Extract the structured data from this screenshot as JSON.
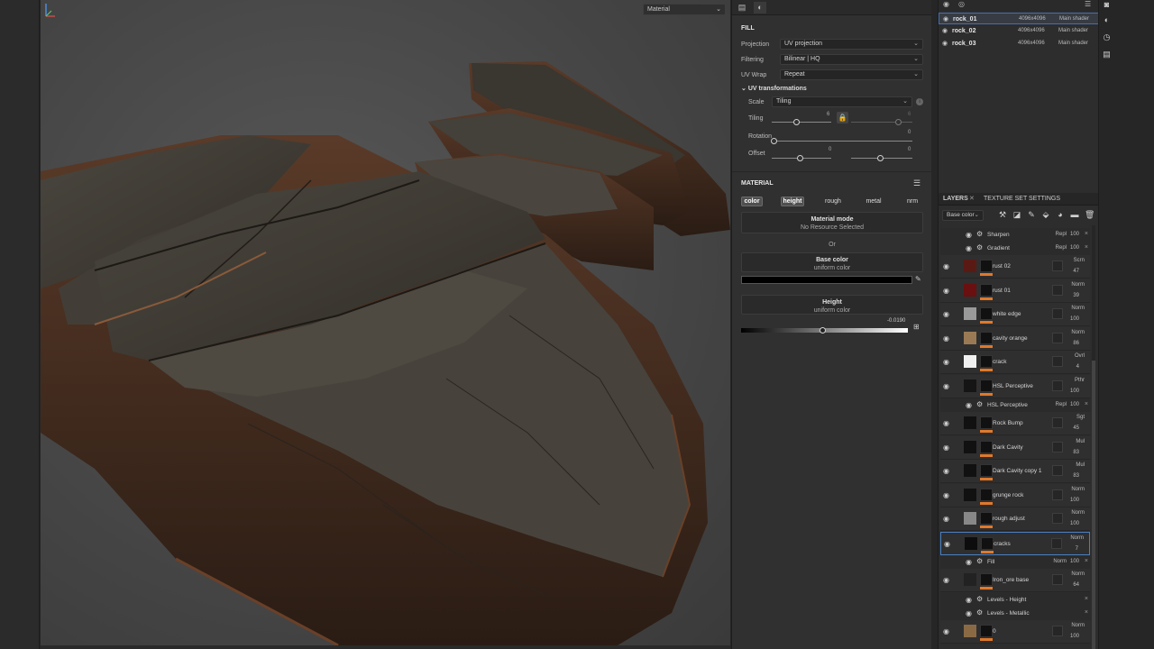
{
  "viewport": {
    "mode_label": "Material"
  },
  "properties": {
    "fill_title": "FILL",
    "projection": {
      "label": "Projection",
      "value": "UV projection"
    },
    "filtering": {
      "label": "Filtering",
      "value": "Bilinear | HQ"
    },
    "uv_wrap": {
      "label": "UV Wrap",
      "value": "Repeat"
    },
    "uv_transformations": "UV transformations",
    "scale": {
      "label": "Scale",
      "value": "Tiling"
    },
    "tiling": {
      "label": "Tiling",
      "value": "6",
      "value2": "6",
      "fraction": 0.41
    },
    "rotation": {
      "label": "Rotation",
      "value": "0",
      "fraction": 0.0
    },
    "offset": {
      "label": "Offset",
      "value": "0",
      "value2": "0",
      "fraction": 0.48,
      "fraction2": 0.48
    },
    "material_title": "MATERIAL",
    "channels": [
      "color",
      "height",
      "rough",
      "metal",
      "nrm"
    ],
    "active_channels": [
      "color",
      "height"
    ],
    "material_mode": {
      "title": "Material mode",
      "sub": "No Resource Selected"
    },
    "or_label": "Or",
    "base_color": {
      "title": "Base color",
      "sub": "uniform color",
      "color": "#000000"
    },
    "height": {
      "title": "Height",
      "sub": "uniform color",
      "value": "-0.0190",
      "fraction": 0.49
    }
  },
  "texture_sets": [
    {
      "name": "rock_01",
      "res": "4096x4096",
      "shader": "Main shader",
      "selected": true
    },
    {
      "name": "rock_02",
      "res": "4096x4096",
      "shader": "Main shader",
      "selected": false
    },
    {
      "name": "rock_03",
      "res": "4096x4096",
      "shader": "Main shader",
      "selected": false
    }
  ],
  "layers_panel": {
    "tab_layers": "LAYERS",
    "tab_close": "✕",
    "tab_settings": "TEXTURE SET SETTINGS",
    "channel_select": "Base color",
    "items": [
      {
        "kind": "sub",
        "name": "Sharpen",
        "blend": "Repl",
        "opacity": "100"
      },
      {
        "kind": "sub",
        "name": "Gradient",
        "blend": "Repl",
        "opacity": "100"
      },
      {
        "kind": "layer",
        "name": "rust 02",
        "blend": "Scrn",
        "opacity": "47",
        "thumb": "#5a1a14"
      },
      {
        "kind": "layer",
        "name": "rust 01",
        "blend": "Norm",
        "opacity": "39",
        "thumb": "#6a1010"
      },
      {
        "kind": "layer",
        "name": "white edge",
        "blend": "Norm",
        "opacity": "100",
        "thumb": "#9a9a9a"
      },
      {
        "kind": "layer",
        "name": "cavity orange",
        "blend": "Norm",
        "opacity": "86",
        "thumb": "#9a7a55"
      },
      {
        "kind": "layer",
        "name": "crack",
        "blend": "Ovrl",
        "opacity": "4",
        "thumb": "#f0f0f0"
      },
      {
        "kind": "layer",
        "name": "HSL Perceptive",
        "blend": "Pthr",
        "opacity": "100",
        "thumb": "#151515"
      },
      {
        "kind": "sub",
        "name": "HSL Perceptive",
        "blend": "Repl",
        "opacity": "100"
      },
      {
        "kind": "layer",
        "name": "Rock Bump",
        "blend": "Sgt",
        "opacity": "45",
        "thumb": "#111111"
      },
      {
        "kind": "layer",
        "name": "Dark Cavity",
        "blend": "Mul",
        "opacity": "83",
        "thumb": "#111111"
      },
      {
        "kind": "layer",
        "name": "Dark Cavity copy 1",
        "blend": "Mul",
        "opacity": "83",
        "thumb": "#111111"
      },
      {
        "kind": "layer",
        "name": "grunge rock",
        "blend": "Norm",
        "opacity": "100",
        "thumb": "#111111"
      },
      {
        "kind": "layer",
        "name": "rough adjust",
        "blend": "Norm",
        "opacity": "100",
        "thumb": "#888888"
      },
      {
        "kind": "layer",
        "name": "cracks",
        "blend": "Norm",
        "opacity": "7",
        "thumb": "#0d0d0d",
        "selected": true
      },
      {
        "kind": "sub",
        "name": "Fill",
        "blend": "Norm",
        "opacity": "100"
      },
      {
        "kind": "layer",
        "name": "Iron_ore base",
        "blend": "Norm",
        "opacity": "64",
        "thumb": "#222222"
      },
      {
        "kind": "sub",
        "name": "Levels - Height",
        "blend": "",
        "opacity": ""
      },
      {
        "kind": "sub",
        "name": "Levels - Metallic",
        "blend": "",
        "opacity": ""
      },
      {
        "kind": "layer",
        "name": "0",
        "blend": "Norm",
        "opacity": "100",
        "thumb": "#8a6a45"
      }
    ]
  }
}
